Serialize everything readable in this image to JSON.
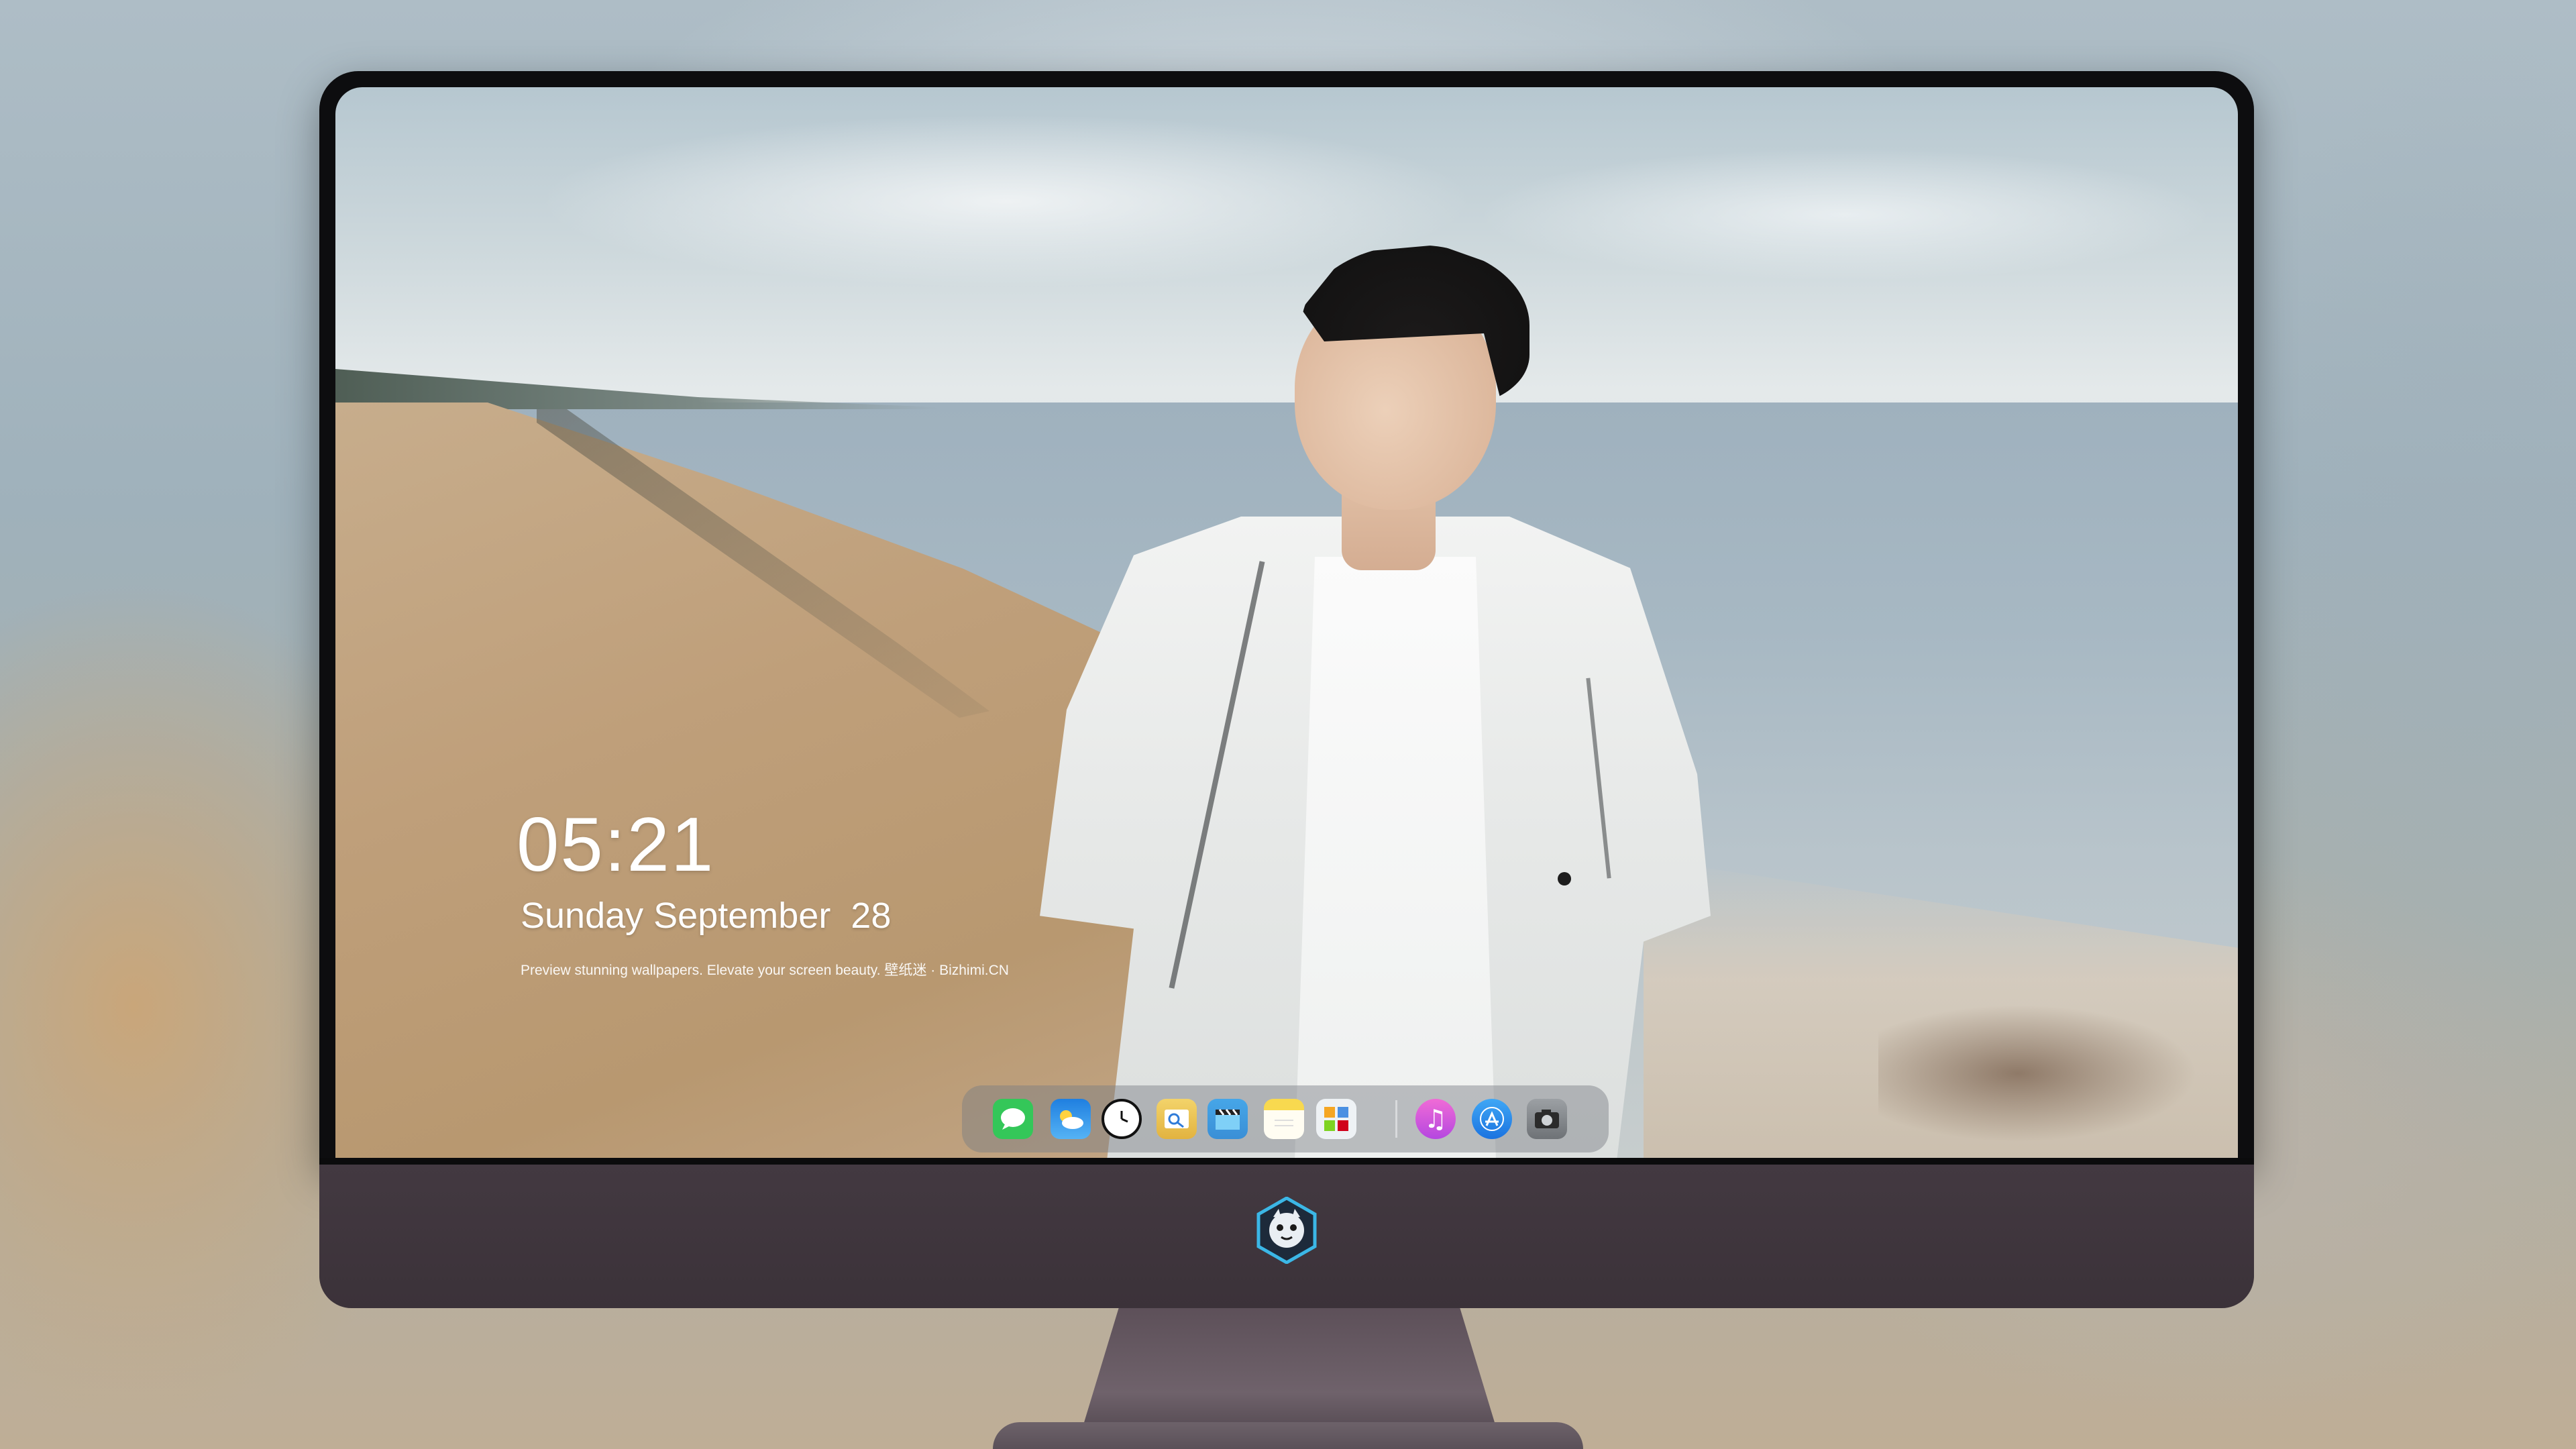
{
  "lockscreen": {
    "time": "05:21",
    "date": "Sunday September  28",
    "tagline": "Preview stunning wallpapers. Elevate your screen beauty. 壁纸迷 · Bizhimi.CN"
  },
  "dock": {
    "apps": [
      {
        "name": "Messages",
        "icon": "messages-icon",
        "color": "#34c759"
      },
      {
        "name": "Weather",
        "icon": "weather-icon",
        "color": "#2f8fe8"
      },
      {
        "name": "Clock",
        "icon": "clock-icon",
        "color": "#111111"
      },
      {
        "name": "Preview",
        "icon": "preview-icon",
        "color": "#e9c660"
      },
      {
        "name": "Clips",
        "icon": "clapboard-icon",
        "color": "#46a6e8"
      },
      {
        "name": "Notes",
        "icon": "notes-icon",
        "color": "#f5d34c"
      },
      {
        "name": "Photos",
        "icon": "photo-grid-icon",
        "color": "#e9eef2"
      },
      {
        "name": "iTunes",
        "icon": "music-icon",
        "color": "#d955d6"
      },
      {
        "name": "App Store",
        "icon": "app-store-icon",
        "color": "#2a8ff1"
      },
      {
        "name": "Camera",
        "icon": "camera-icon",
        "color": "#8a8e92"
      }
    ]
  },
  "colors": {
    "chin": "#433941",
    "bezel": "#0d0d0f",
    "text": "#ffffff"
  }
}
